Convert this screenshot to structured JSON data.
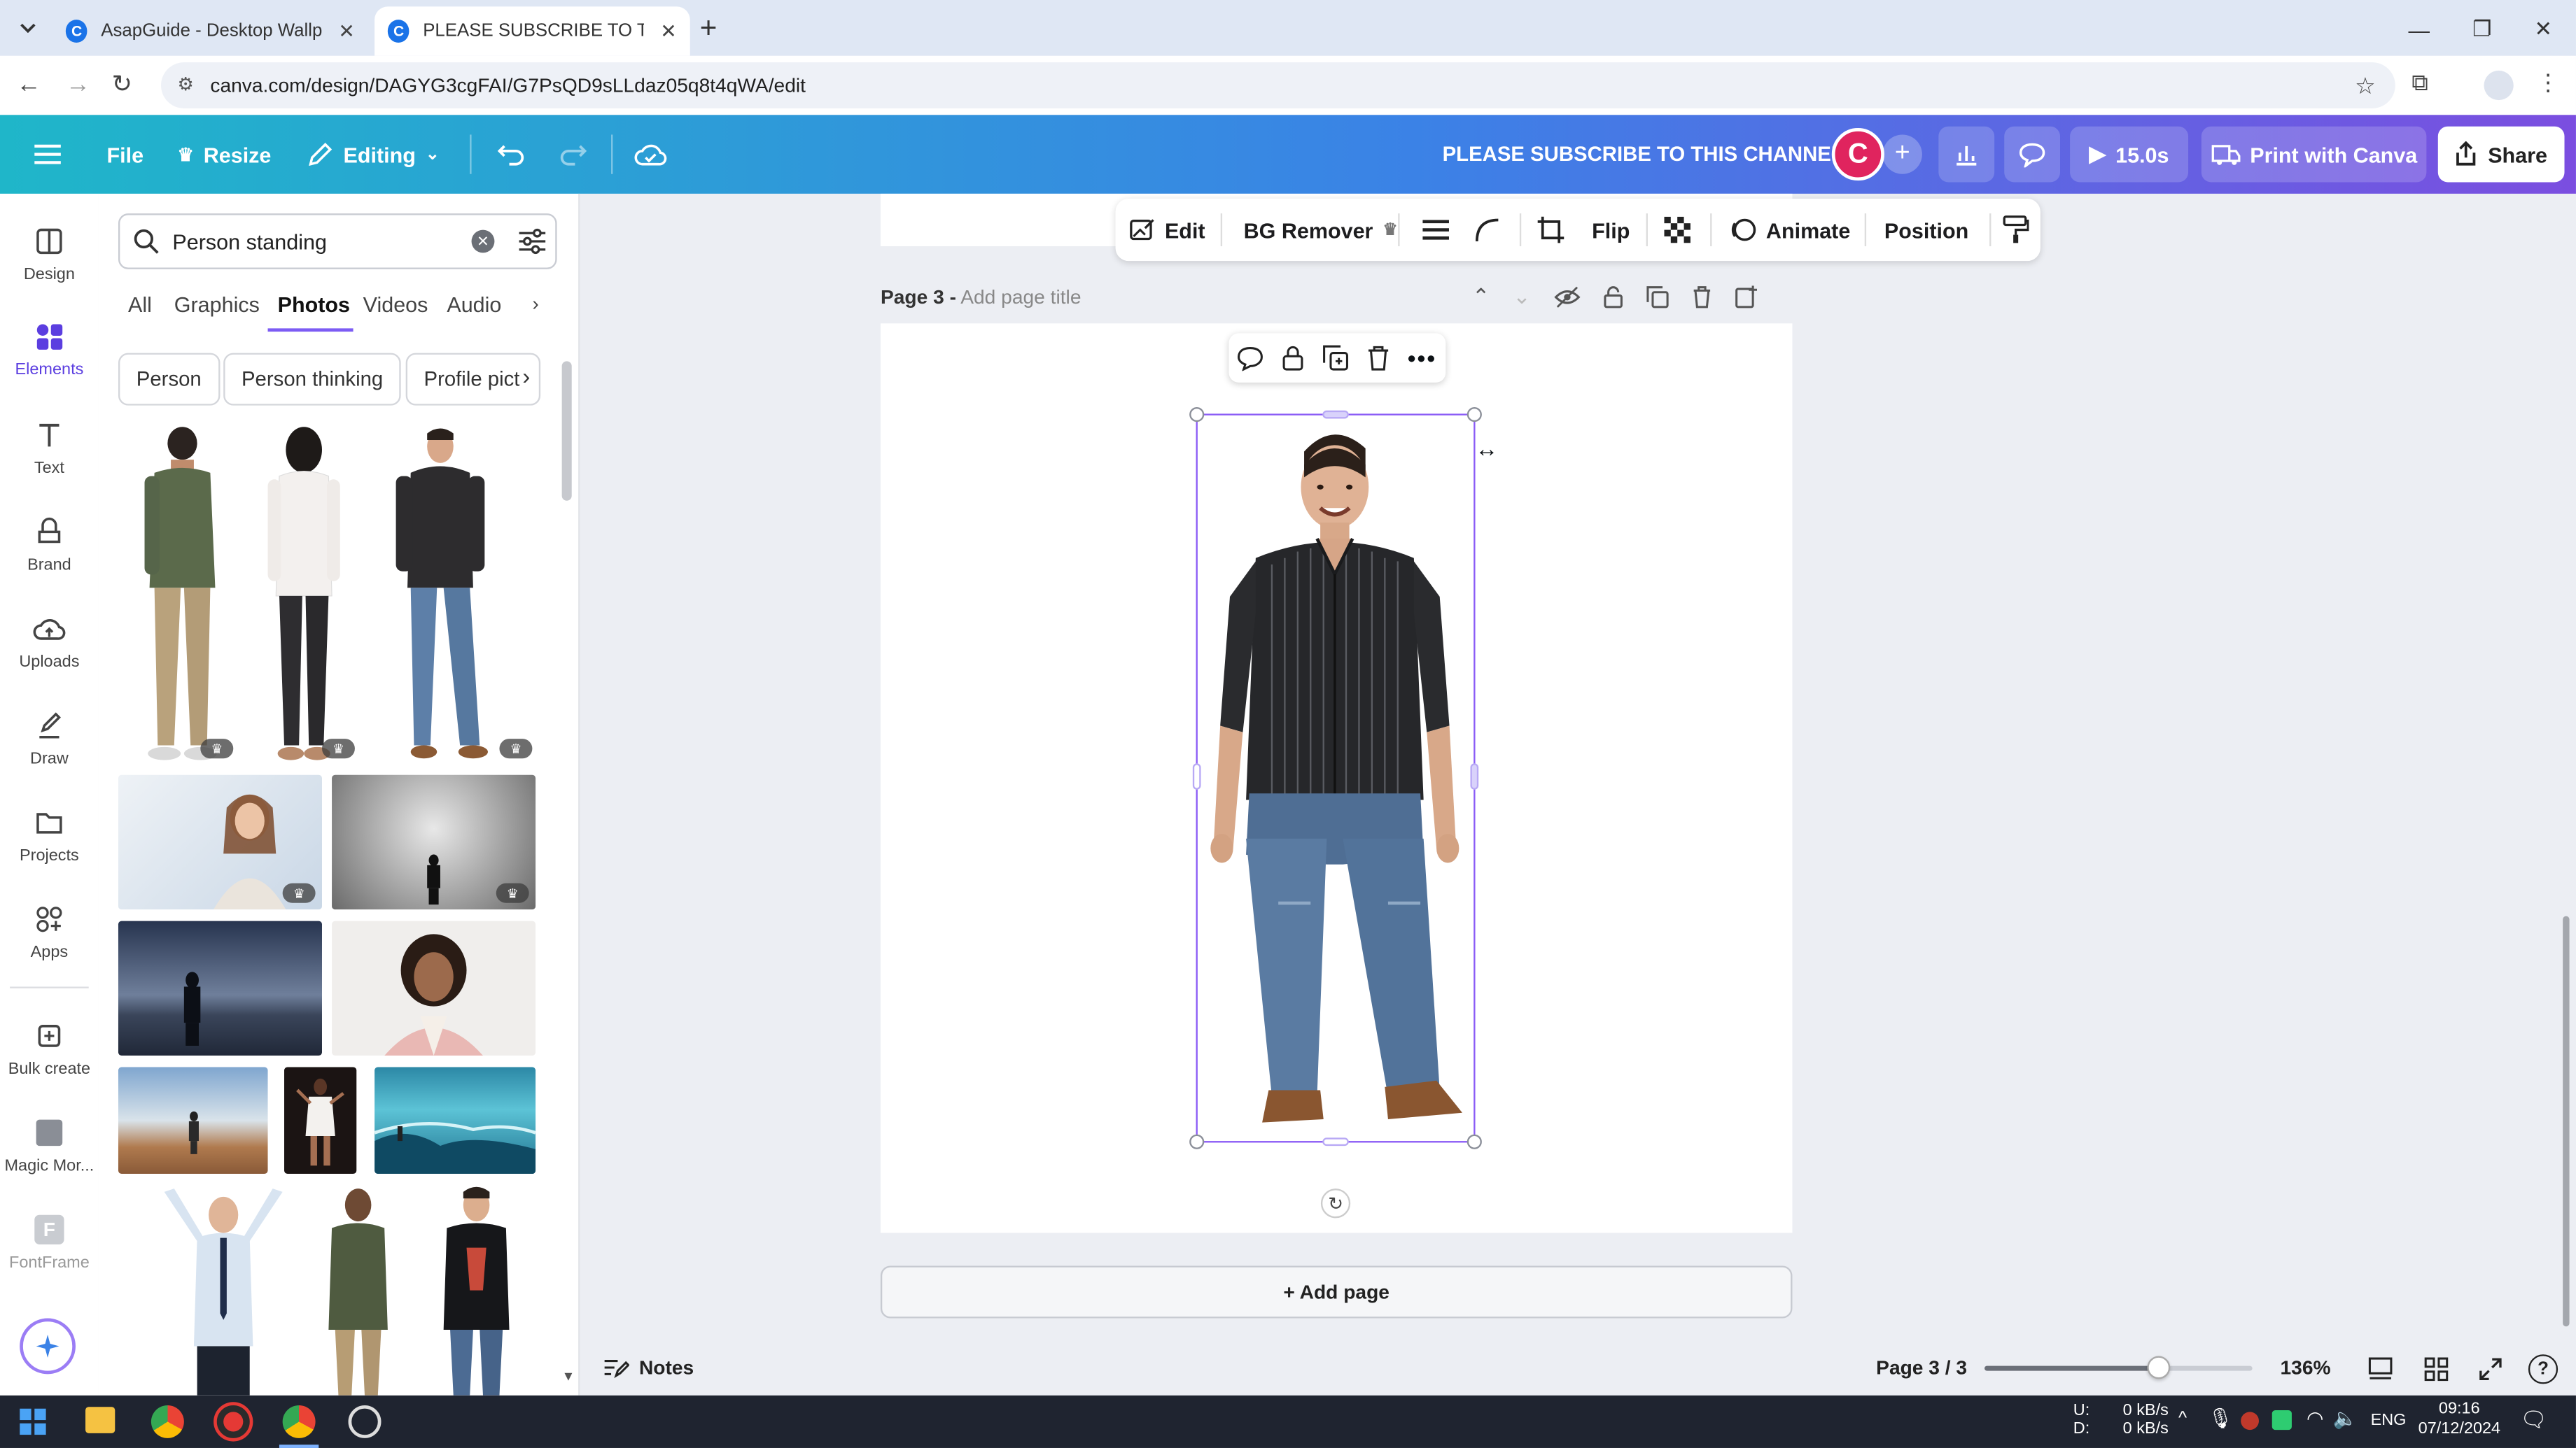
{
  "browser": {
    "tabs": [
      {
        "title": "AsapGuide - Desktop Wallpape",
        "active": false
      },
      {
        "title": "PLEASE SUBSCRIBE TO THIS CH",
        "active": true
      }
    ],
    "url": "canva.com/design/DAGYG3cgFAI/G7PsQD9sLLdaz05q8t4qWA/edit"
  },
  "header": {
    "file": "File",
    "resize": "Resize",
    "editing": "Editing",
    "design_title": "PLEASE SUBSCRIBE TO THIS CHANNEL",
    "avatar_letter": "C",
    "play_duration": "15.0s",
    "print": "Print with Canva",
    "share": "Share"
  },
  "rail": {
    "items": [
      {
        "label": "Design",
        "icon": "design-icon"
      },
      {
        "label": "Elements",
        "icon": "elements-icon"
      },
      {
        "label": "Text",
        "icon": "text-icon"
      },
      {
        "label": "Brand",
        "icon": "brand-icon"
      },
      {
        "label": "Uploads",
        "icon": "uploads-icon"
      },
      {
        "label": "Draw",
        "icon": "draw-icon"
      },
      {
        "label": "Projects",
        "icon": "projects-icon"
      },
      {
        "label": "Apps",
        "icon": "apps-icon"
      },
      {
        "label": "Bulk create",
        "icon": "bulk-create-icon"
      },
      {
        "label": "Magic Mor...",
        "icon": "magic-morph-icon"
      },
      {
        "label": "FontFrame",
        "icon": "fontframe-icon"
      }
    ]
  },
  "panel": {
    "search_value": "Person standing",
    "tabs": [
      "All",
      "Graphics",
      "Photos",
      "Videos",
      "Audio"
    ],
    "active_tab": "Photos",
    "chips": [
      "Person",
      "Person thinking",
      "Profile pict"
    ]
  },
  "context_toolbar": {
    "edit": "Edit",
    "bg_remover": "BG Remover",
    "flip": "Flip",
    "animate": "Animate",
    "position": "Position"
  },
  "page": {
    "label": "Page 3 -",
    "title_placeholder": "Add page title",
    "add_page": "+ Add page"
  },
  "status": {
    "notes": "Notes",
    "page_counter": "Page 3 / 3",
    "zoom": "136%",
    "zoom_fraction": 0.65
  },
  "taskbar": {
    "net_up": "0 kB/s",
    "net_down": "0 kB/s",
    "net_u_label": "U:",
    "net_d_label": "D:",
    "lang": "ENG",
    "time": "09:16",
    "date": "07/12/2024"
  },
  "colors": {
    "accent_purple": "#8b5cf6",
    "avatar": "#e0245e",
    "selection": "#8b5cf6"
  }
}
